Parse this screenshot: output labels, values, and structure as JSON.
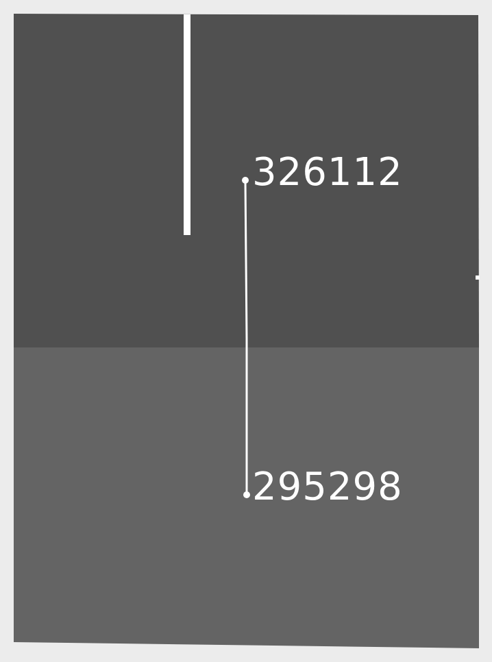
{
  "map": {
    "colors": {
      "background": "#ececec",
      "region_upper": "#505050",
      "region_lower": "#646464",
      "line": "#ffffff",
      "label": "#ffffff"
    },
    "points": [
      {
        "id": "point-upper",
        "label": "326112"
      },
      {
        "id": "point-lower",
        "label": "295298"
      }
    ]
  }
}
